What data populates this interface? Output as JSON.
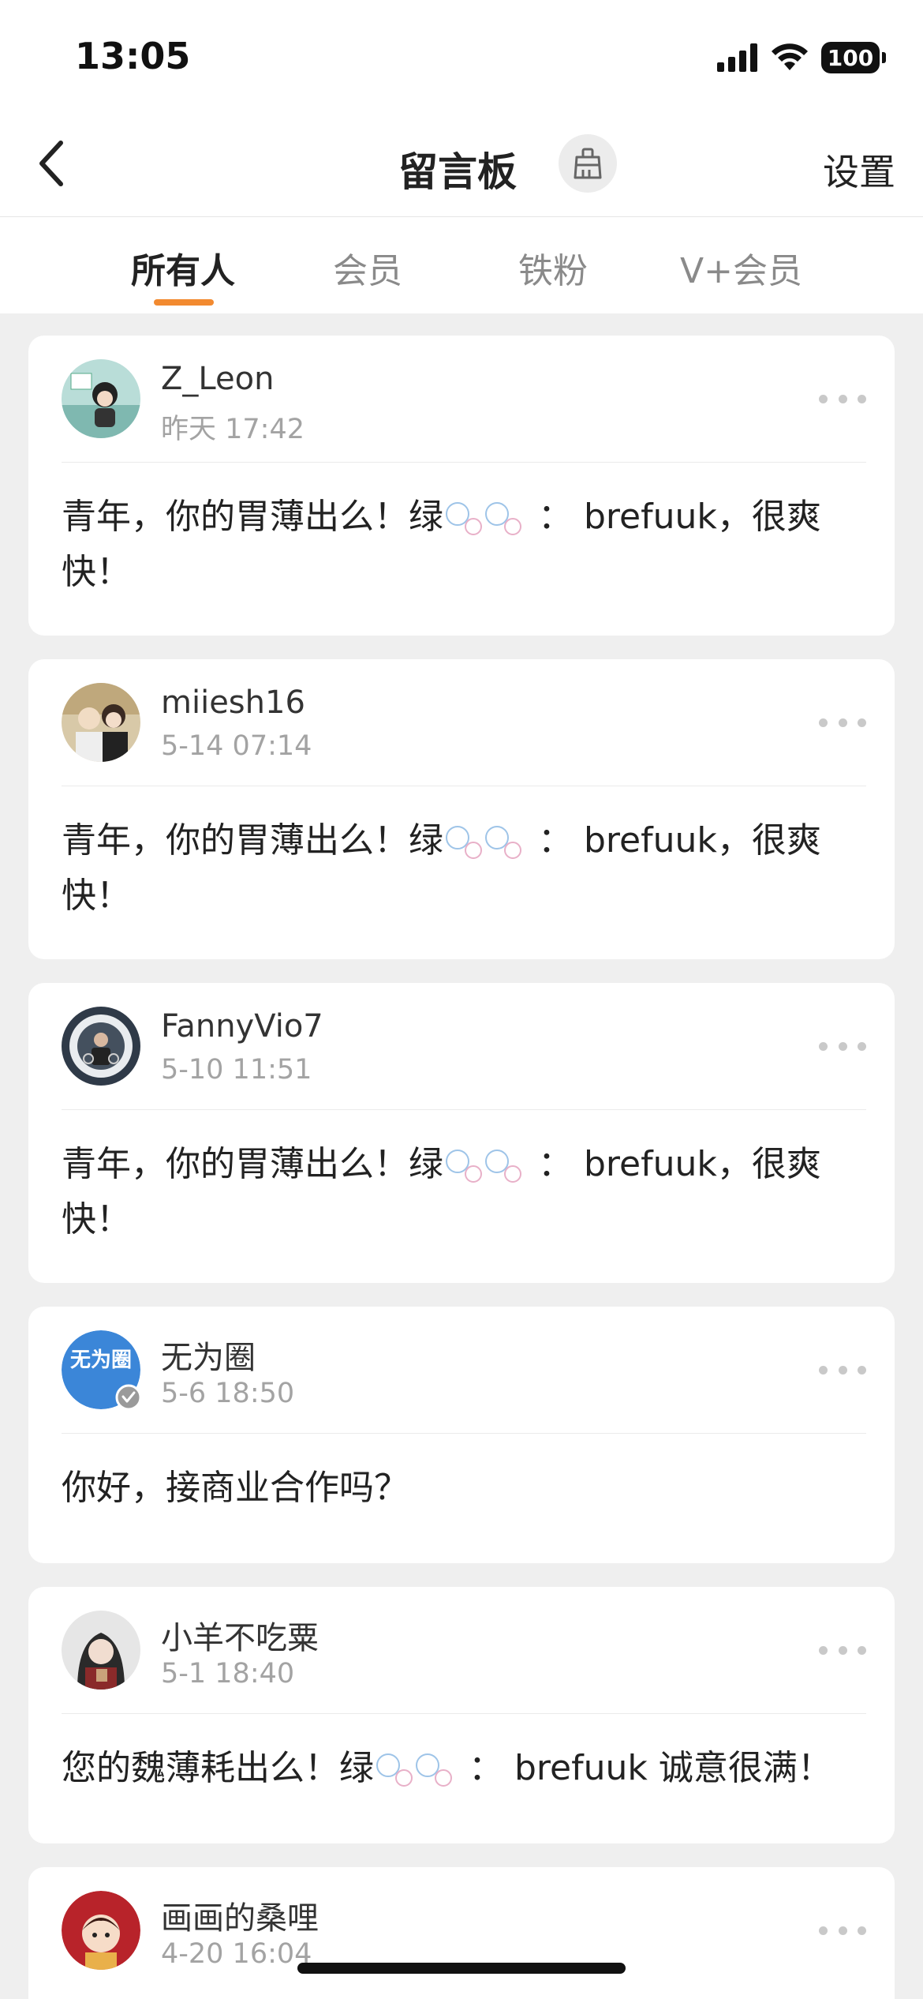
{
  "status_bar": {
    "time": "13:05",
    "battery": "100"
  },
  "nav": {
    "title": "留言板",
    "settings_label": "设置"
  },
  "tabs": [
    {
      "label": "所有人",
      "active": true
    },
    {
      "label": "会员",
      "active": false
    },
    {
      "label": "铁粉",
      "active": false
    },
    {
      "label": "V+会员",
      "active": false
    }
  ],
  "messages": [
    {
      "username": "Z_Leon",
      "time": "昨天 17:42",
      "text_before": "青年，你的胃薄出么！绿",
      "text_after": "：  brefuuk，很爽快！",
      "has_bubbles": true
    },
    {
      "username": "miiesh16",
      "time": "5-14 07:14",
      "text_before": "青年，你的胃薄出么！绿",
      "text_after": "：  brefuuk，很爽快！",
      "has_bubbles": true
    },
    {
      "username": "FannyVio7",
      "time": "5-10 11:51",
      "text_before": "青年，你的胃薄出么！绿",
      "text_after": "：  brefuuk，很爽快！",
      "has_bubbles": true
    },
    {
      "username": "无为圈",
      "time": "5-6 18:50",
      "text_before": "你好，接商业合作吗？",
      "text_after": "",
      "has_bubbles": false,
      "verified": true,
      "avatar_text": "无为圈"
    },
    {
      "username": "小羊不吃粟",
      "time": "5-1 18:40",
      "text_before": "您的魏薄耗出么！绿",
      "text_after": "：  brefuuk 诚意很满！",
      "has_bubbles": true
    },
    {
      "username": "画画的桑哩",
      "time": "4-20 16:04",
      "text_before": "",
      "text_after": "",
      "has_bubbles": false
    }
  ],
  "colors": {
    "accent": "#f28a30",
    "background": "#efefef",
    "secondary_text": "#a3a3a3",
    "verified_badge": "#9a9a9a"
  }
}
